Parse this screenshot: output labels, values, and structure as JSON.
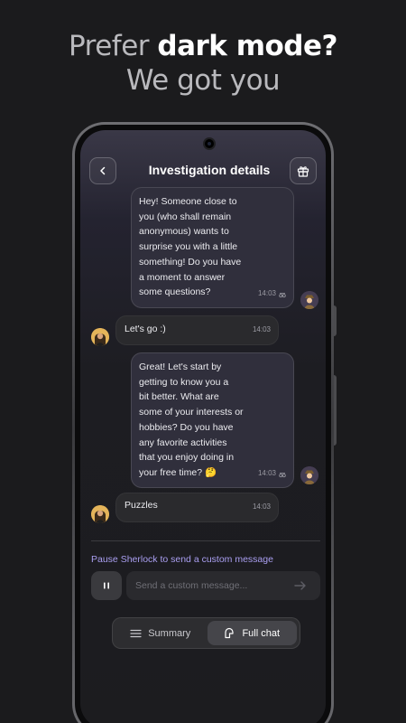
{
  "promo": {
    "line1_prefix": "Prefer",
    "line1_bold": "dark mode?",
    "line2": "We got you"
  },
  "header": {
    "title": "Investigation details",
    "back_icon": "chevron-left-icon",
    "gift_icon": "gift-icon"
  },
  "messages": [
    {
      "sender": "bot",
      "lines": [
        "Hey! Someone close to",
        "you (who shall remain",
        "anonymous) wants to",
        "surprise you with a little",
        "something! Do you have",
        "a moment to answer",
        "some questions?"
      ],
      "time": "14:03"
    },
    {
      "sender": "user",
      "text": "Let's go :)",
      "time": "14:03"
    },
    {
      "sender": "bot",
      "lines": [
        "Great! Let's start by",
        "getting to know you a",
        "bit better. What are",
        "some of your interests or",
        "hobbies? Do you have",
        "any favorite activities",
        "that you enjoy doing in",
        "your free time? 🤔"
      ],
      "time": "14:03"
    },
    {
      "sender": "user",
      "text": "Puzzles",
      "time": "14:03"
    }
  ],
  "composer": {
    "pause_hint": "Pause Sherlock to send a custom message",
    "placeholder": "Send a custom message..."
  },
  "view_toggle": {
    "summary_label": "Summary",
    "full_chat_label": "Full chat",
    "active": "full_chat"
  },
  "colors": {
    "background": "#1b1b1d",
    "accent": "#a99ef0",
    "bot_bubble": "#302f3c",
    "user_bubble": "#2a2a2d"
  }
}
